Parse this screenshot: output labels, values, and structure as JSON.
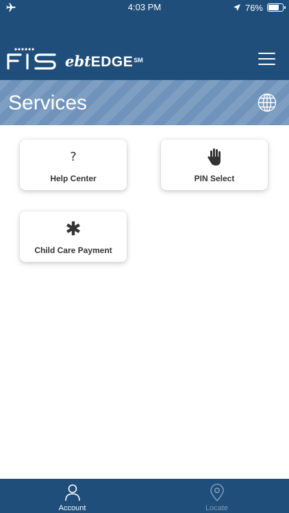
{
  "status_bar": {
    "left_icon": "airplane-mode-icon",
    "time": "4:03 PM",
    "location_icon": "location-arrow-icon",
    "battery_text": "76%",
    "battery_level": 0.76
  },
  "header": {
    "logo_icon": "fis-logo-icon",
    "product_ebt": "ebt",
    "product_edge": "EDGE",
    "product_mark": "SM",
    "menu_icon": "hamburger-menu-icon"
  },
  "banner": {
    "title": "Services",
    "language_icon": "globe-icon"
  },
  "services": [
    {
      "label": "Help Center",
      "icon": "question-mark-icon",
      "glyph": "?"
    },
    {
      "label": "PIN Select",
      "icon": "hand-icon"
    },
    {
      "label": "Child Care Payment",
      "icon": "asterisk-icon",
      "glyph": "✱"
    }
  ],
  "tabs": [
    {
      "label": "Account",
      "icon": "person-icon",
      "active": true
    },
    {
      "label": "Locate",
      "icon": "map-pin-icon",
      "active": false
    }
  ],
  "colors": {
    "header_bg": "#1f4e7a",
    "banner_bg": "#6f93bb",
    "tab_active": "#ffffff",
    "tab_inactive": "#7f9ab8",
    "tile_text": "#333333"
  }
}
